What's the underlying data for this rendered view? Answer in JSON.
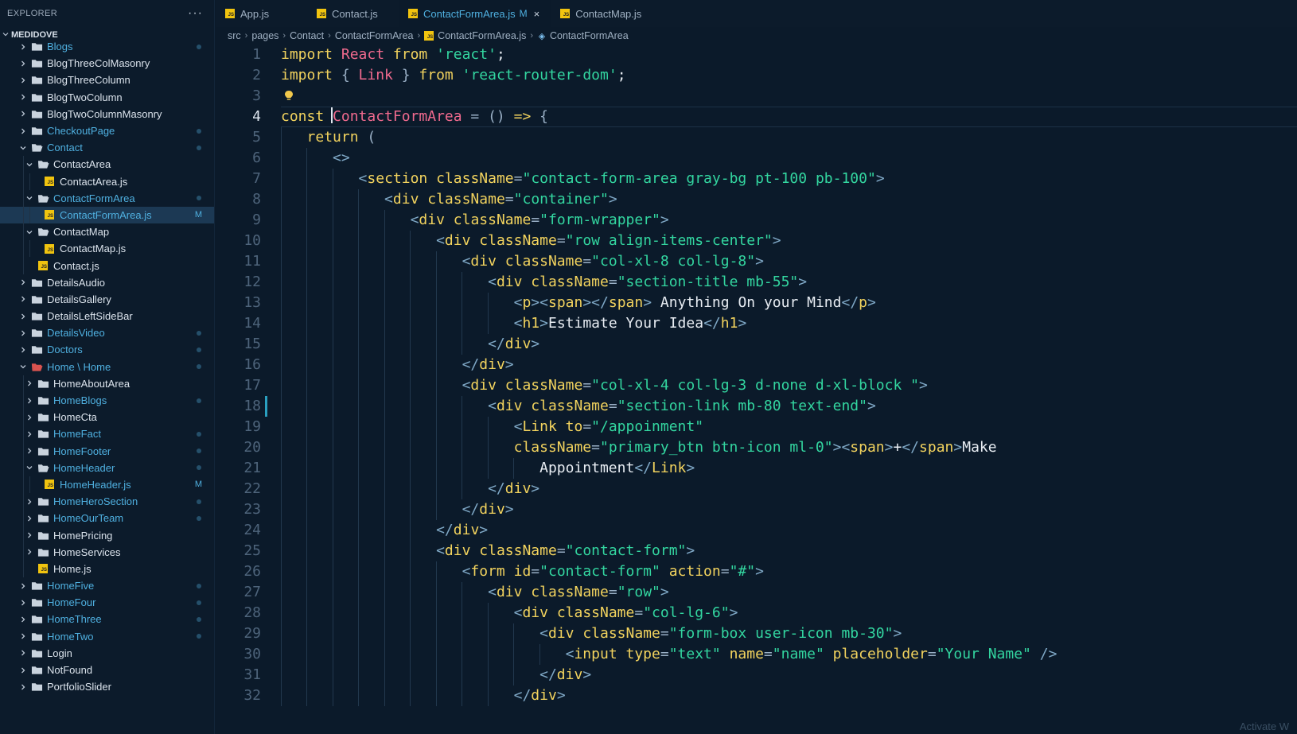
{
  "sidebar": {
    "title": "EXPLORER",
    "more": "···",
    "project": "MEDIDOVE",
    "items": [
      {
        "label": "Blogs",
        "depth": 0,
        "type": "folder",
        "open": false,
        "git": true,
        "status": "dot"
      },
      {
        "label": "BlogThreeColMasonry",
        "depth": 0,
        "type": "folder",
        "open": false,
        "git": false
      },
      {
        "label": "BlogThreeColumn",
        "depth": 0,
        "type": "folder",
        "open": false,
        "git": false
      },
      {
        "label": "BlogTwoColumn",
        "depth": 0,
        "type": "folder",
        "open": false,
        "git": false
      },
      {
        "label": "BlogTwoColumnMasonry",
        "depth": 0,
        "type": "folder",
        "open": false,
        "git": false
      },
      {
        "label": "CheckoutPage",
        "depth": 0,
        "type": "folder",
        "open": false,
        "git": true,
        "status": "dot"
      },
      {
        "label": "Contact",
        "depth": 0,
        "type": "folder",
        "open": true,
        "git": true,
        "status": "dot"
      },
      {
        "label": "ContactArea",
        "depth": 1,
        "type": "folder",
        "open": true,
        "git": false
      },
      {
        "label": "ContactArea.js",
        "depth": 2,
        "type": "js",
        "git": false
      },
      {
        "label": "ContactFormArea",
        "depth": 1,
        "type": "folder",
        "open": true,
        "git": true,
        "status": "dot"
      },
      {
        "label": "ContactFormArea.js",
        "depth": 2,
        "type": "js",
        "git": true,
        "status": "M",
        "selected": true
      },
      {
        "label": "ContactMap",
        "depth": 1,
        "type": "folder",
        "open": true,
        "git": false
      },
      {
        "label": "ContactMap.js",
        "depth": 2,
        "type": "js",
        "git": false
      },
      {
        "label": "Contact.js",
        "depth": 1,
        "type": "js",
        "git": false
      },
      {
        "label": "DetailsAudio",
        "depth": 0,
        "type": "folder",
        "open": false,
        "git": false
      },
      {
        "label": "DetailsGallery",
        "depth": 0,
        "type": "folder",
        "open": false,
        "git": false
      },
      {
        "label": "DetailsLeftSideBar",
        "depth": 0,
        "type": "folder",
        "open": false,
        "git": false
      },
      {
        "label": "DetailsVideo",
        "depth": 0,
        "type": "folder",
        "open": false,
        "git": true,
        "status": "dot"
      },
      {
        "label": "Doctors",
        "depth": 0,
        "type": "folder",
        "open": false,
        "git": true,
        "status": "dot"
      },
      {
        "label": "Home \\ Home",
        "depth": 0,
        "type": "folder-red",
        "open": true,
        "git": true,
        "status": "dot"
      },
      {
        "label": "HomeAboutArea",
        "depth": 1,
        "type": "folder",
        "open": false,
        "git": false
      },
      {
        "label": "HomeBlogs",
        "depth": 1,
        "type": "folder",
        "open": false,
        "git": true,
        "status": "dot"
      },
      {
        "label": "HomeCta",
        "depth": 1,
        "type": "folder",
        "open": false,
        "git": false
      },
      {
        "label": "HomeFact",
        "depth": 1,
        "type": "folder",
        "open": false,
        "git": true,
        "status": "dot"
      },
      {
        "label": "HomeFooter",
        "depth": 1,
        "type": "folder",
        "open": false,
        "git": true,
        "status": "dot"
      },
      {
        "label": "HomeHeader",
        "depth": 1,
        "type": "folder",
        "open": true,
        "git": true,
        "status": "dot"
      },
      {
        "label": "HomeHeader.js",
        "depth": 2,
        "type": "js",
        "git": true,
        "status": "M"
      },
      {
        "label": "HomeHeroSection",
        "depth": 1,
        "type": "folder",
        "open": false,
        "git": true,
        "status": "dot"
      },
      {
        "label": "HomeOurTeam",
        "depth": 1,
        "type": "folder",
        "open": false,
        "git": true,
        "status": "dot"
      },
      {
        "label": "HomePricing",
        "depth": 1,
        "type": "folder",
        "open": false,
        "git": false
      },
      {
        "label": "HomeServices",
        "depth": 1,
        "type": "folder",
        "open": false,
        "git": false
      },
      {
        "label": "Home.js",
        "depth": 1,
        "type": "js",
        "git": false
      },
      {
        "label": "HomeFive",
        "depth": 0,
        "type": "folder",
        "open": false,
        "git": true,
        "status": "dot"
      },
      {
        "label": "HomeFour",
        "depth": 0,
        "type": "folder",
        "open": false,
        "git": true,
        "status": "dot"
      },
      {
        "label": "HomeThree",
        "depth": 0,
        "type": "folder",
        "open": false,
        "git": true,
        "status": "dot"
      },
      {
        "label": "HomeTwo",
        "depth": 0,
        "type": "folder",
        "open": false,
        "git": true,
        "status": "dot"
      },
      {
        "label": "Login",
        "depth": 0,
        "type": "folder",
        "open": false,
        "git": false
      },
      {
        "label": "NotFound",
        "depth": 0,
        "type": "folder",
        "open": false,
        "git": false
      },
      {
        "label": "PortfolioSlider",
        "depth": 0,
        "type": "folder",
        "open": false,
        "git": false
      }
    ]
  },
  "tabs": [
    {
      "label": "App.js",
      "active": false,
      "modified": false
    },
    {
      "label": "Contact.js",
      "active": false,
      "modified": false
    },
    {
      "label": "ContactFormArea.js",
      "active": true,
      "modified": true,
      "modified_mark": "M",
      "close": "×"
    },
    {
      "label": "ContactMap.js",
      "active": false,
      "modified": false
    }
  ],
  "breadcrumb": {
    "parts": [
      "src",
      "pages",
      "Contact",
      "ContactFormArea"
    ],
    "file": "ContactFormArea.js",
    "symbol": "ContactFormArea"
  },
  "editor": {
    "current_line": 4,
    "modified_line": 18,
    "lines": [
      [
        [
          "kw",
          "import "
        ],
        [
          "cls",
          "React "
        ],
        [
          "kw",
          "from "
        ],
        [
          "str",
          "'react'"
        ],
        [
          "plain",
          ";"
        ]
      ],
      [
        [
          "kw",
          "import "
        ],
        [
          "punc",
          "{ "
        ],
        [
          "cls",
          "Link "
        ],
        [
          "punc",
          "} "
        ],
        [
          "kw",
          "from "
        ],
        [
          "str",
          "'react-router-dom'"
        ],
        [
          "plain",
          ";"
        ]
      ],
      [],
      [
        [
          "kw2",
          "const "
        ],
        [
          "cls",
          "ContactFormArea "
        ],
        [
          "punc",
          "= () "
        ],
        [
          "kw",
          "=> "
        ],
        [
          "punc",
          "{"
        ]
      ],
      [
        [
          "plain",
          "   "
        ],
        [
          "kw",
          "return "
        ],
        [
          "punc",
          "("
        ]
      ],
      [
        [
          "plain",
          "      "
        ],
        [
          "tagb",
          "<>"
        ]
      ],
      [
        [
          "plain",
          "         "
        ],
        [
          "tagb",
          "<"
        ],
        [
          "attr",
          "section "
        ],
        [
          "attr",
          "className"
        ],
        [
          "punc",
          "="
        ],
        [
          "str",
          "\"contact-form-area gray-bg pt-100 pb-100\""
        ],
        [
          "tagb",
          ">"
        ]
      ],
      [
        [
          "plain",
          "            "
        ],
        [
          "tagb",
          "<"
        ],
        [
          "attr",
          "div "
        ],
        [
          "attr",
          "className"
        ],
        [
          "punc",
          "="
        ],
        [
          "str",
          "\"container\""
        ],
        [
          "tagb",
          ">"
        ]
      ],
      [
        [
          "plain",
          "               "
        ],
        [
          "tagb",
          "<"
        ],
        [
          "attr",
          "div "
        ],
        [
          "attr",
          "className"
        ],
        [
          "punc",
          "="
        ],
        [
          "str",
          "\"form-wrapper\""
        ],
        [
          "tagb",
          ">"
        ]
      ],
      [
        [
          "plain",
          "                  "
        ],
        [
          "tagb",
          "<"
        ],
        [
          "attr",
          "div "
        ],
        [
          "attr",
          "className"
        ],
        [
          "punc",
          "="
        ],
        [
          "str",
          "\"row align-items-center\""
        ],
        [
          "tagb",
          ">"
        ]
      ],
      [
        [
          "plain",
          "                     "
        ],
        [
          "tagb",
          "<"
        ],
        [
          "attr",
          "div "
        ],
        [
          "attr",
          "className"
        ],
        [
          "punc",
          "="
        ],
        [
          "str",
          "\"col-xl-8 col-lg-8\""
        ],
        [
          "tagb",
          ">"
        ]
      ],
      [
        [
          "plain",
          "                        "
        ],
        [
          "tagb",
          "<"
        ],
        [
          "attr",
          "div "
        ],
        [
          "attr",
          "className"
        ],
        [
          "punc",
          "="
        ],
        [
          "str",
          "\"section-title mb-55\""
        ],
        [
          "tagb",
          ">"
        ]
      ],
      [
        [
          "plain",
          "                           "
        ],
        [
          "tagb",
          "<"
        ],
        [
          "attr",
          "p"
        ],
        [
          "tagb",
          "><"
        ],
        [
          "attr",
          "span"
        ],
        [
          "tagb",
          "></"
        ],
        [
          "attr",
          "span"
        ],
        [
          "tagb",
          "> "
        ],
        [
          "txt",
          "Anything On your Mind"
        ],
        [
          "tagb",
          "</"
        ],
        [
          "attr",
          "p"
        ],
        [
          "tagb",
          ">"
        ]
      ],
      [
        [
          "plain",
          "                           "
        ],
        [
          "tagb",
          "<"
        ],
        [
          "attr",
          "h1"
        ],
        [
          "tagb",
          ">"
        ],
        [
          "txt",
          "Estimate Your Idea"
        ],
        [
          "tagb",
          "</"
        ],
        [
          "attr",
          "h1"
        ],
        [
          "tagb",
          ">"
        ]
      ],
      [
        [
          "plain",
          "                        "
        ],
        [
          "tagb",
          "</"
        ],
        [
          "attr",
          "div"
        ],
        [
          "tagb",
          ">"
        ]
      ],
      [
        [
          "plain",
          "                     "
        ],
        [
          "tagb",
          "</"
        ],
        [
          "attr",
          "div"
        ],
        [
          "tagb",
          ">"
        ]
      ],
      [
        [
          "plain",
          "                     "
        ],
        [
          "tagb",
          "<"
        ],
        [
          "attr",
          "div "
        ],
        [
          "attr",
          "className"
        ],
        [
          "punc",
          "="
        ],
        [
          "str",
          "\"col-xl-4 col-lg-3 d-none d-xl-block \""
        ],
        [
          "tagb",
          ">"
        ]
      ],
      [
        [
          "plain",
          "                        "
        ],
        [
          "tagb",
          "<"
        ],
        [
          "attr",
          "div "
        ],
        [
          "attr",
          "className"
        ],
        [
          "punc",
          "="
        ],
        [
          "str",
          "\"section-link mb-80 text-end\""
        ],
        [
          "tagb",
          ">"
        ]
      ],
      [
        [
          "plain",
          "                           "
        ],
        [
          "tagb",
          "<"
        ],
        [
          "attr",
          "Link "
        ],
        [
          "attr",
          "to"
        ],
        [
          "punc",
          "="
        ],
        [
          "str",
          "\"/appoinment\""
        ]
      ],
      [
        [
          "plain",
          "                           "
        ],
        [
          "attr",
          "className"
        ],
        [
          "punc",
          "="
        ],
        [
          "str",
          "\"primary_btn btn-icon ml-0\""
        ],
        [
          "tagb",
          "><"
        ],
        [
          "attr",
          "span"
        ],
        [
          "tagb",
          ">"
        ],
        [
          "txt",
          "+"
        ],
        [
          "tagb",
          "</"
        ],
        [
          "attr",
          "span"
        ],
        [
          "tagb",
          ">"
        ],
        [
          "txt",
          "Make"
        ]
      ],
      [
        [
          "plain",
          "                              "
        ],
        [
          "txt",
          "Appointment"
        ],
        [
          "tagb",
          "</"
        ],
        [
          "attr",
          "Link"
        ],
        [
          "tagb",
          ">"
        ]
      ],
      [
        [
          "plain",
          "                        "
        ],
        [
          "tagb",
          "</"
        ],
        [
          "attr",
          "div"
        ],
        [
          "tagb",
          ">"
        ]
      ],
      [
        [
          "plain",
          "                     "
        ],
        [
          "tagb",
          "</"
        ],
        [
          "attr",
          "div"
        ],
        [
          "tagb",
          ">"
        ]
      ],
      [
        [
          "plain",
          "                  "
        ],
        [
          "tagb",
          "</"
        ],
        [
          "attr",
          "div"
        ],
        [
          "tagb",
          ">"
        ]
      ],
      [
        [
          "plain",
          "                  "
        ],
        [
          "tagb",
          "<"
        ],
        [
          "attr",
          "div "
        ],
        [
          "attr",
          "className"
        ],
        [
          "punc",
          "="
        ],
        [
          "str",
          "\"contact-form\""
        ],
        [
          "tagb",
          ">"
        ]
      ],
      [
        [
          "plain",
          "                     "
        ],
        [
          "tagb",
          "<"
        ],
        [
          "attr",
          "form "
        ],
        [
          "attr",
          "id"
        ],
        [
          "punc",
          "="
        ],
        [
          "str",
          "\"contact-form\" "
        ],
        [
          "attr",
          "action"
        ],
        [
          "punc",
          "="
        ],
        [
          "str",
          "\"#\""
        ],
        [
          "tagb",
          ">"
        ]
      ],
      [
        [
          "plain",
          "                        "
        ],
        [
          "tagb",
          "<"
        ],
        [
          "attr",
          "div "
        ],
        [
          "attr",
          "className"
        ],
        [
          "punc",
          "="
        ],
        [
          "str",
          "\"row\""
        ],
        [
          "tagb",
          ">"
        ]
      ],
      [
        [
          "plain",
          "                           "
        ],
        [
          "tagb",
          "<"
        ],
        [
          "attr",
          "div "
        ],
        [
          "attr",
          "className"
        ],
        [
          "punc",
          "="
        ],
        [
          "str",
          "\"col-lg-6\""
        ],
        [
          "tagb",
          ">"
        ]
      ],
      [
        [
          "plain",
          "                              "
        ],
        [
          "tagb",
          "<"
        ],
        [
          "attr",
          "div "
        ],
        [
          "attr",
          "className"
        ],
        [
          "punc",
          "="
        ],
        [
          "str",
          "\"form-box user-icon mb-30\""
        ],
        [
          "tagb",
          ">"
        ]
      ],
      [
        [
          "plain",
          "                                 "
        ],
        [
          "tagb",
          "<"
        ],
        [
          "attr",
          "input "
        ],
        [
          "attr",
          "type"
        ],
        [
          "punc",
          "="
        ],
        [
          "str",
          "\"text\" "
        ],
        [
          "attr",
          "name"
        ],
        [
          "punc",
          "="
        ],
        [
          "str",
          "\"name\" "
        ],
        [
          "attr",
          "placeholder"
        ],
        [
          "punc",
          "="
        ],
        [
          "str",
          "\"Your Name\" "
        ],
        [
          "tagb",
          "/>"
        ]
      ],
      [
        [
          "plain",
          "                              "
        ],
        [
          "tagb",
          "</"
        ],
        [
          "attr",
          "div"
        ],
        [
          "tagb",
          ">"
        ]
      ],
      [
        [
          "plain",
          "                           "
        ],
        [
          "tagb",
          "</"
        ],
        [
          "attr",
          "div"
        ],
        [
          "tagb",
          ">"
        ]
      ]
    ]
  },
  "watermark": "Activate W"
}
